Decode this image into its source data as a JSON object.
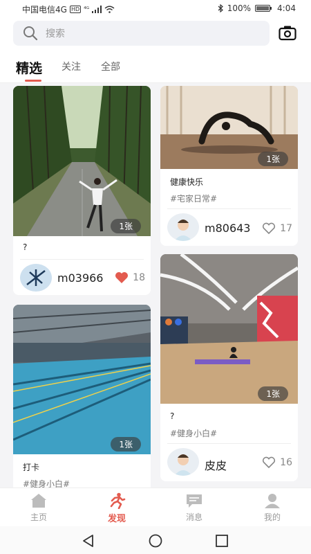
{
  "status_bar": {
    "carrier": "中国电信4G",
    "hd": "HD",
    "network": "⁴ᴳ",
    "battery": "100%",
    "time": "4:04"
  },
  "search": {
    "placeholder": "搜索"
  },
  "tabs": [
    {
      "label": "精选",
      "active": true
    },
    {
      "label": "关注",
      "active": false
    },
    {
      "label": "全部",
      "active": false
    }
  ],
  "colors": {
    "accent": "#e35b4f",
    "liked": "#e35b4f"
  },
  "feed": {
    "cards": [
      {
        "photo": "forest-road-photo",
        "count": "1张",
        "title": "?",
        "tag": "",
        "user": "m03966",
        "likes": "18",
        "liked": true
      },
      {
        "photo": "yoga-pose-photo",
        "count": "1张",
        "title": "健康快乐",
        "tag": "#宅家日常#",
        "user": "m80643",
        "likes": "17",
        "liked": false
      },
      {
        "photo": "swimming-pool-photo",
        "count": "1张",
        "title": "打卡",
        "tag": "#健身小白#",
        "user": "",
        "likes": "",
        "liked": false
      },
      {
        "photo": "gym-hall-photo",
        "count": "1张",
        "title": "?",
        "tag": "#健身小白#",
        "user": "皮皮",
        "likes": "16",
        "liked": false
      }
    ]
  },
  "bottom_nav": [
    {
      "label": "主页",
      "icon": "home-icon",
      "active": false
    },
    {
      "label": "发现",
      "icon": "runner-icon",
      "active": true
    },
    {
      "label": "消息",
      "icon": "message-icon",
      "active": false
    },
    {
      "label": "我的",
      "icon": "profile-icon",
      "active": false
    }
  ]
}
